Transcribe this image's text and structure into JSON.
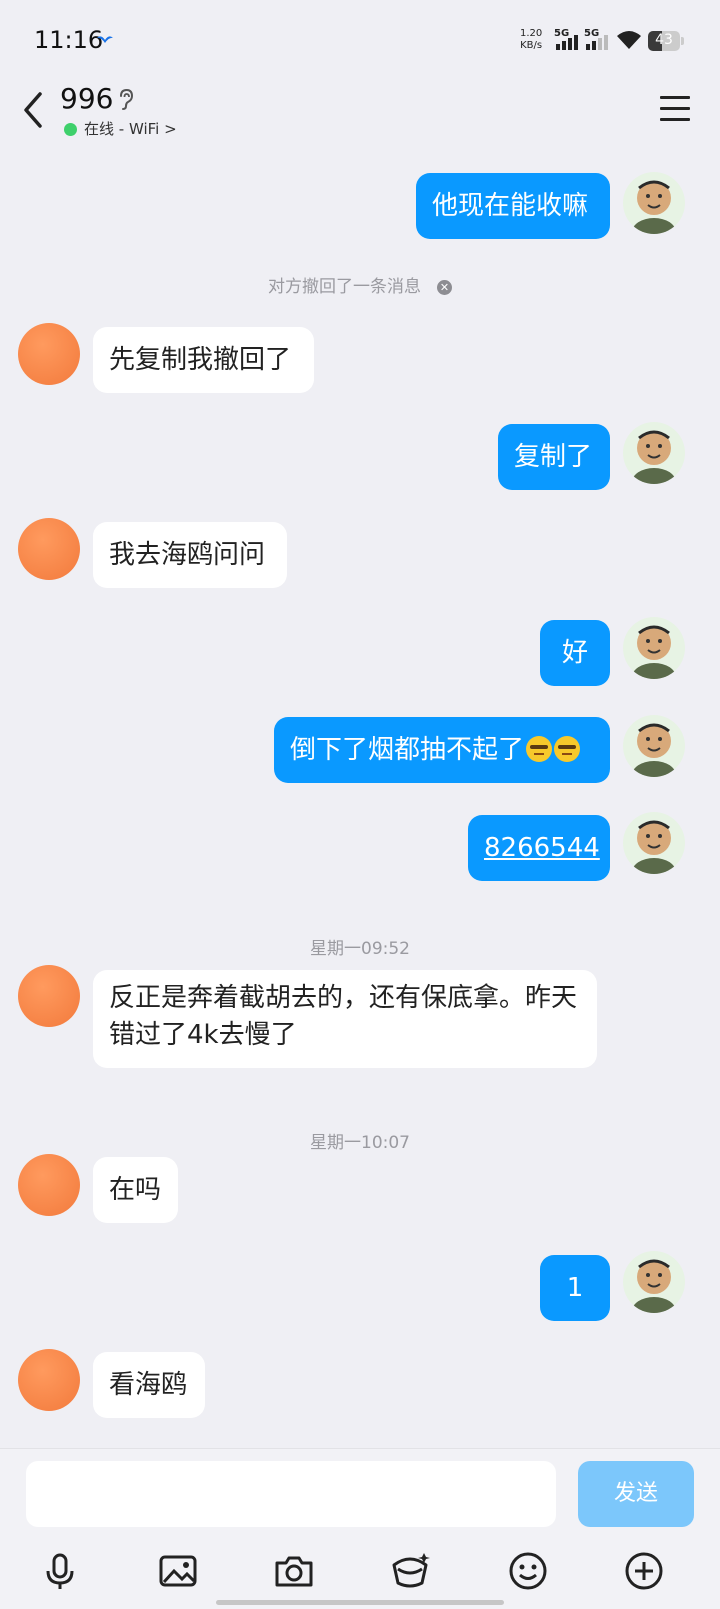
{
  "status_bar": {
    "time": "11:16",
    "speed_value": "1.20",
    "speed_unit": "KB/s",
    "sim1": "5G",
    "sim2": "5G",
    "battery": "43",
    "battery_level": 0.43
  },
  "header": {
    "title": "996",
    "status": "在线 - WiFi >"
  },
  "messages": [
    {
      "from": "me",
      "text": "他现在能收嘛"
    },
    {
      "type": "system",
      "text": "对方撤回了一条消息"
    },
    {
      "from": "other",
      "text": "先复制我撤回了"
    },
    {
      "from": "me",
      "text": "复制了"
    },
    {
      "from": "other",
      "text": "我去海鸥问问"
    },
    {
      "from": "me",
      "text": "好"
    },
    {
      "from": "me",
      "text": "倒下了烟都抽不起了",
      "emoji": "smug-face-emoji"
    },
    {
      "from": "me",
      "text": "8266544",
      "link": true
    },
    {
      "type": "time",
      "text": "星期一09:52"
    },
    {
      "from": "other",
      "text": "反正是奔着截胡去的，还有保底拿。昨天错过了4k去慢了"
    },
    {
      "type": "time",
      "text": "星期一10:07"
    },
    {
      "from": "other",
      "text": "在吗"
    },
    {
      "from": "me",
      "text": "1"
    },
    {
      "from": "other",
      "text": "看海鸥"
    }
  ],
  "input": {
    "placeholder": "",
    "send_label": "发送"
  },
  "toolbar": {
    "icons": [
      "microphone-icon",
      "image-icon",
      "camera-icon",
      "red-packet-icon",
      "emoji-icon",
      "plus-icon"
    ]
  },
  "colors": {
    "me_bubble": "#0a99ff",
    "other_bubble": "#ffffff",
    "background": "#efeff4",
    "send_button": "#7cc7fb",
    "online": "#3ed06b"
  }
}
